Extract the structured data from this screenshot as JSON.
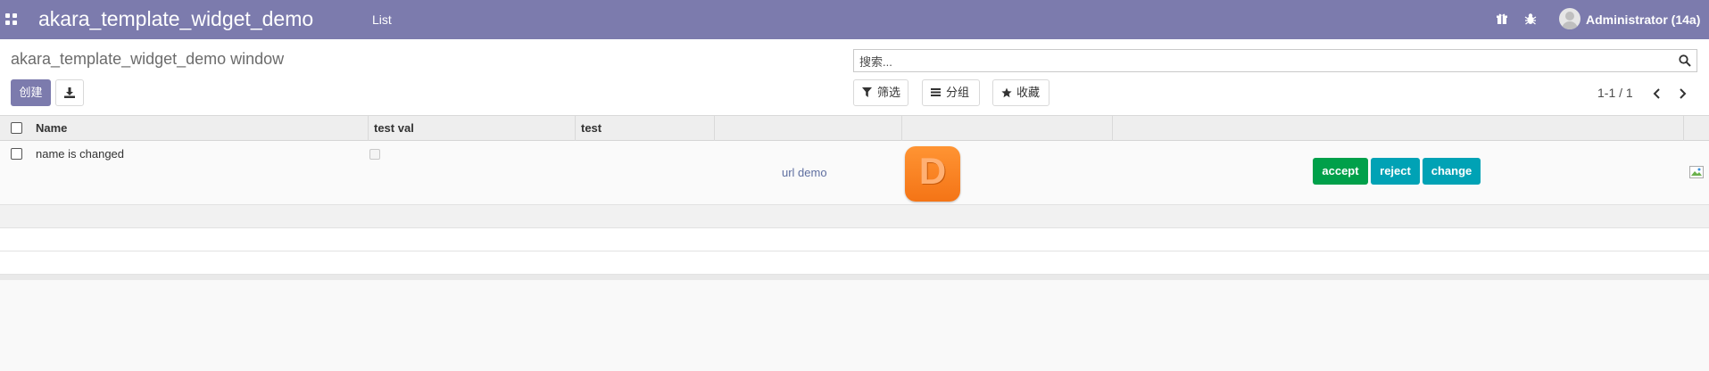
{
  "navbar": {
    "apps_icon": "grid-icon",
    "brand": "akara_template_widget_demo",
    "menu_list": "List",
    "icons": [
      "gift-icon",
      "bug-icon"
    ],
    "user": "Administrator (14a)"
  },
  "control_panel": {
    "breadcrumb": "akara_template_widget_demo window",
    "create_label": "创建",
    "download_icon": "download-icon",
    "search": {
      "placeholder": "搜索...",
      "value": ""
    },
    "filters_label": "筛选",
    "groupby_label": "分组",
    "favorites_label": "收藏",
    "pager": "1-1 / 1"
  },
  "table": {
    "columns": [
      "Name",
      "test val",
      "test",
      "",
      "",
      ""
    ],
    "rows": [
      {
        "name": "name is changed",
        "test_val": false,
        "url_text": "url demo",
        "logo_letter": "D",
        "buttons": [
          {
            "label": "accept",
            "color": "#00a04a"
          },
          {
            "label": "reject",
            "color": "#00a2b5"
          },
          {
            "label": "change",
            "color": "#00a2b5"
          }
        ]
      }
    ]
  },
  "colors": {
    "navbar": "#7c7bad",
    "primary": "#7c7bad",
    "accept": "#00a04a",
    "info": "#00a2b5",
    "logo": "#f47416"
  }
}
